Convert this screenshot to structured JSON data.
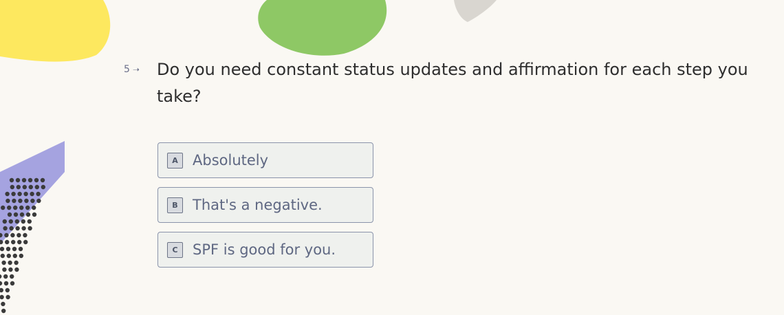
{
  "question": {
    "number": "5",
    "arrow_icon": "arrow-right-icon",
    "text": "Do you need constant status updates and affirmation for each step you take?"
  },
  "choices": [
    {
      "key": "A",
      "label": "Absolutely"
    },
    {
      "key": "B",
      "label": "That's a negative."
    },
    {
      "key": "C",
      "label": "SPF is good for you."
    }
  ],
  "colors": {
    "background": "#faf8f3",
    "yellow_blob": "#fde85f",
    "green_blob": "#8ec865",
    "gray_blob": "#d9d6d0",
    "purple_shape": "#a5a3e0",
    "dots": "#3b3b3b",
    "choice_border": "#8a93aa",
    "choice_text": "#5e6782"
  }
}
